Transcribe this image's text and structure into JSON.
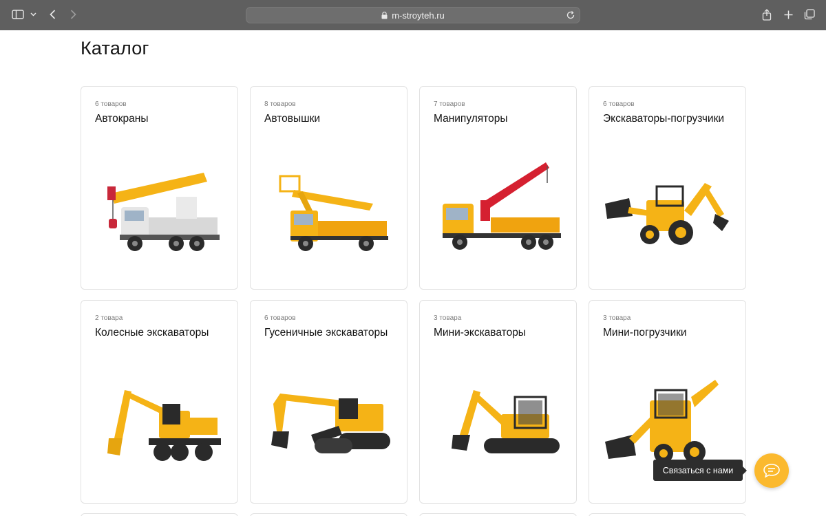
{
  "browser": {
    "url": "m-stroyteh.ru",
    "icons": [
      "sidebar-icon",
      "chevron-down-icon",
      "back-icon",
      "forward-icon",
      "lock-icon",
      "reload-icon",
      "share-icon",
      "plus-icon",
      "tabs-icon"
    ]
  },
  "page": {
    "title": "Каталог"
  },
  "catalog": [
    {
      "count": "6 товаров",
      "name": "Автокраны",
      "image": "truck-crane"
    },
    {
      "count": "8 товаров",
      "name": "Автовышки",
      "image": "aerial-platform"
    },
    {
      "count": "7 товаров",
      "name": "Манипуляторы",
      "image": "crane-manipulator"
    },
    {
      "count": "6 товаров",
      "name": "Экскаваторы-погрузчики",
      "image": "backhoe-loader"
    },
    {
      "count": "2 товара",
      "name": "Колесные экскаваторы",
      "image": "wheeled-excavator"
    },
    {
      "count": "6 товаров",
      "name": "Гусеничные экскаваторы",
      "image": "crawler-excavator"
    },
    {
      "count": "3 товара",
      "name": "Мини-экскаваторы",
      "image": "mini-excavator"
    },
    {
      "count": "3 товара",
      "name": "Мини-погрузчики",
      "image": "skid-steer-loader"
    }
  ],
  "chat": {
    "label": "Связаться с нами",
    "icon": "chat-bubble-icon"
  },
  "colors": {
    "accent": "#fbb92e",
    "machine_yellow": "#f5b316",
    "chrome": "#5f5f5f"
  }
}
